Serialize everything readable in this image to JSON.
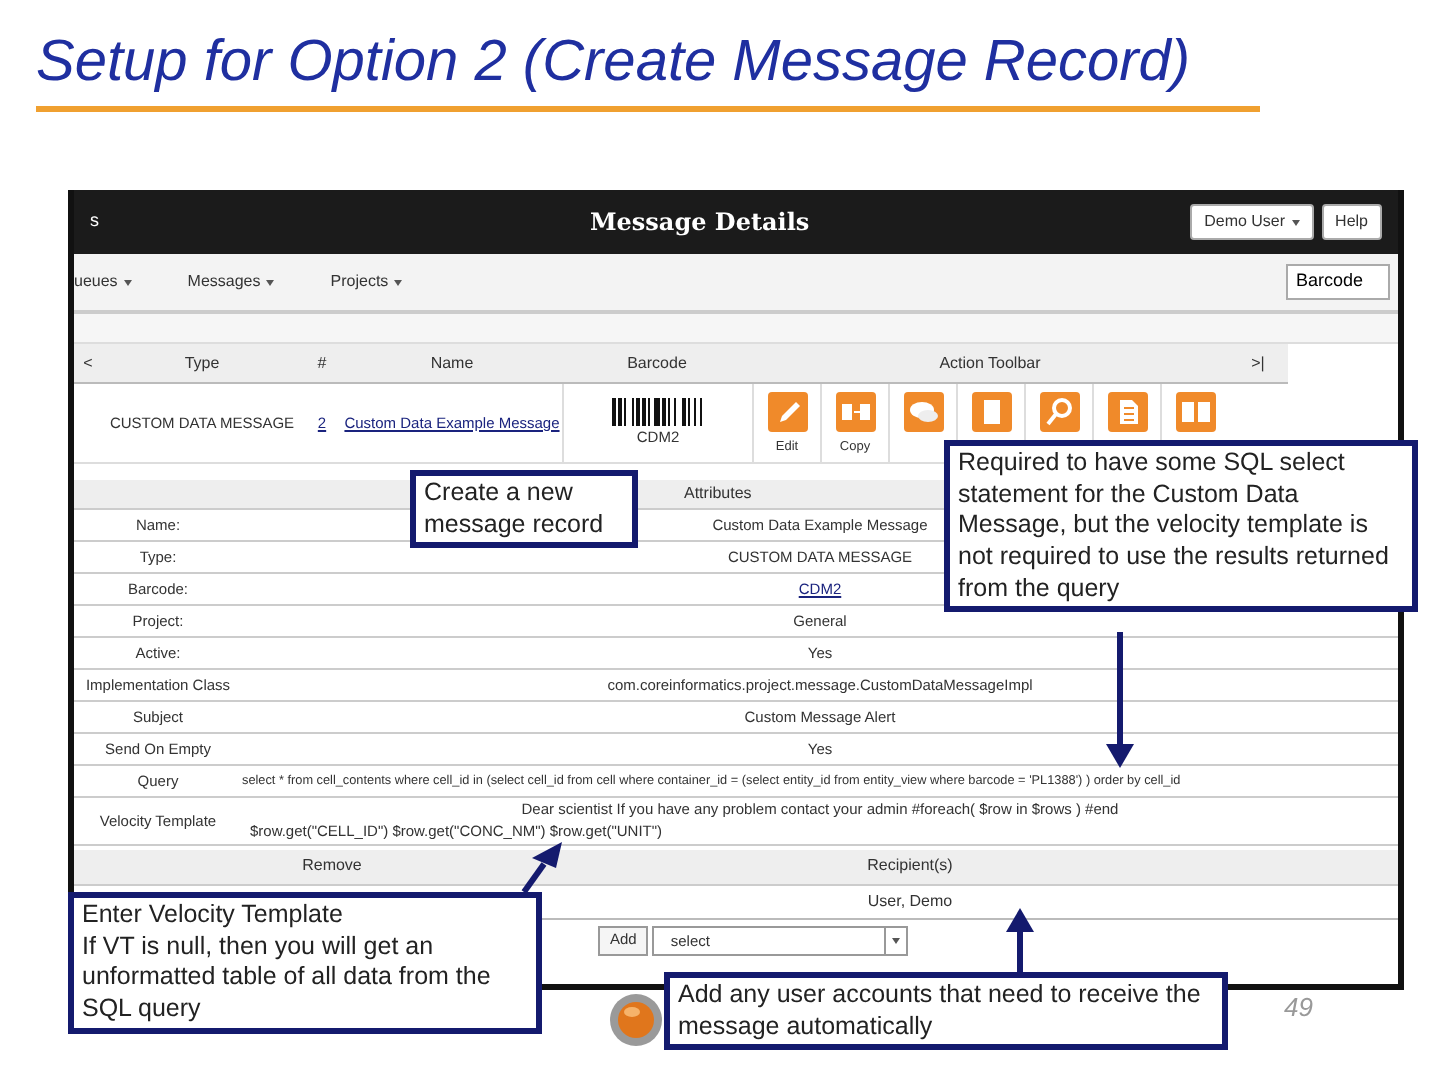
{
  "slide": {
    "title": "Setup for Option 2 (Create Message Record)",
    "page_number": "49"
  },
  "app": {
    "header": {
      "left_text": "s",
      "title": "Message Details",
      "user_button": "Demo User",
      "help_button": "Help"
    },
    "menus": [
      {
        "label": "ueues"
      },
      {
        "label": "Messages"
      },
      {
        "label": "Projects"
      }
    ],
    "lookup_field": {
      "value": "Barcode"
    },
    "list_table": {
      "columns": [
        "<",
        "Type",
        "#",
        "Name",
        "Barcode",
        "Action Toolbar",
        ">|"
      ],
      "row": {
        "type": "CUSTOM DATA MESSAGE",
        "number": "2",
        "name": "Custom Data Example Message",
        "barcode": "CDM2"
      },
      "actions": [
        {
          "kind": "edit",
          "label": "Edit"
        },
        {
          "kind": "copy",
          "label": "Copy"
        },
        {
          "kind": "comment"
        },
        {
          "kind": "document"
        },
        {
          "kind": "search"
        },
        {
          "kind": "report"
        },
        {
          "kind": "book"
        }
      ]
    },
    "details": {
      "header": "Attributes",
      "rows": [
        {
          "label": "Name:",
          "value": [
            "Custom Data Example Message"
          ],
          "kind": "text"
        },
        {
          "label": "Type:",
          "value": [
            "CUSTOM DATA MESSAGE"
          ],
          "kind": "text"
        },
        {
          "label": "Barcode:",
          "value": [
            "CDM2"
          ],
          "kind": "link"
        },
        {
          "label": "Project:",
          "value": [
            "General"
          ],
          "kind": "text"
        },
        {
          "label": "Active:",
          "value": [
            "Yes"
          ],
          "kind": "text"
        },
        {
          "label": "Implementation Class",
          "value": [
            "com.coreinformatics.project.message.CustomDataMessageImpl"
          ],
          "kind": "text"
        },
        {
          "label": "Subject",
          "value": [
            "Custom Message Alert"
          ],
          "kind": "text"
        },
        {
          "label": "Send On Empty",
          "value": [
            "Yes"
          ],
          "kind": "text"
        },
        {
          "label": "Query",
          "value": [
            "select * from cell_contents where cell_id in (select cell_id from cell where container_id = (select entity_id from entity_view where barcode = 'PL1388') ) order by cell_id"
          ],
          "kind": "code"
        },
        {
          "label": "Velocity Template",
          "value": [
            "Dear scientist If you have any problem contact your admin #foreach( $row in $rows ) #end",
            "$row.get(\"CELL_ID\") $row.get(\"CONC_NM\") $row.get(\"UNIT\")"
          ],
          "kind": "text"
        }
      ]
    },
    "recipients": {
      "columns": [
        "Remove",
        "Recipient(s)"
      ],
      "rows": [
        {
          "name": "User, Demo"
        }
      ],
      "add_button": "Add",
      "select": {
        "value": "select"
      }
    }
  },
  "callouts": [
    {
      "lines": [
        "Create a new message record"
      ]
    },
    {
      "lines": [
        "Required to have some SQL select statement for the Custom Data Message, but the velocity template is not required to use the results returned from the query"
      ]
    },
    {
      "lines": [
        "Enter Velocity Template",
        "If VT is null, then you will get an unformatted table of all data from the SQL query"
      ]
    },
    {
      "lines": [
        "Add any user accounts that need to receive the message automatically"
      ]
    }
  ]
}
